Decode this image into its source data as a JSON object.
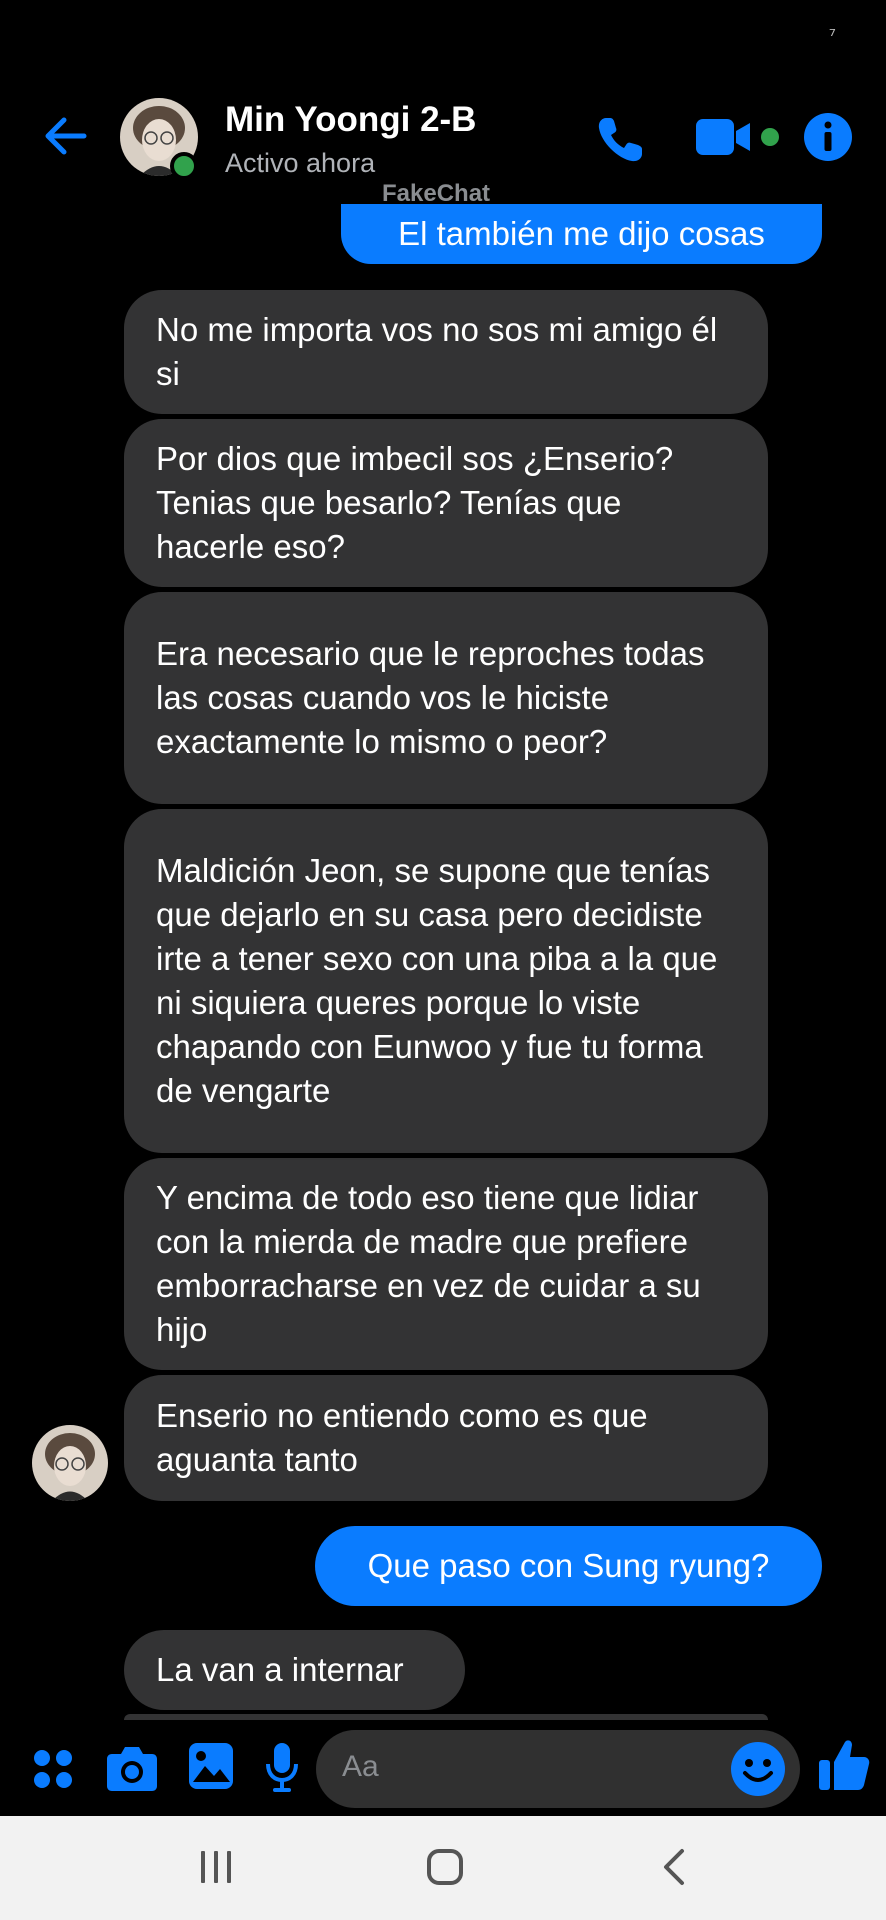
{
  "header": {
    "contact_name": "Min Yoongi 2-B",
    "contact_status": "Activo ahora",
    "watermark": "FakeChat"
  },
  "messages": [
    {
      "side": "sent",
      "text": "El también me dijo cosas"
    },
    {
      "side": "received",
      "text": "No me importa vos no sos mi amigo él si"
    },
    {
      "side": "received",
      "text": "Por dios que imbecil sos ¿Enserio? Tenias que besarlo? Tenías que hacerle eso?"
    },
    {
      "side": "received",
      "text": "Era necesario que le reproches todas las cosas cuando vos le hiciste exactamente lo mismo o peor?"
    },
    {
      "side": "received",
      "text": "Maldición Jeon, se supone que tenías que dejarlo en su casa pero decidiste irte a tener sexo con una piba a la que ni siquiera queres porque lo viste chapando con Eunwoo y fue tu forma de vengarte"
    },
    {
      "side": "received",
      "text": "Y encima de todo eso tiene que lidiar con la mierda de madre que prefiere emborracharse en vez de cuidar a su hijo"
    },
    {
      "side": "received",
      "text": "Enserio no entiendo como es que aguanta tanto"
    },
    {
      "side": "sent",
      "text": "Que paso con Sung ryung?"
    },
    {
      "side": "received",
      "text": "La van a internar"
    }
  ],
  "composer": {
    "placeholder": "Aa",
    "icons": [
      "apps-icon",
      "camera-icon",
      "gallery-icon",
      "microphone-icon",
      "emoji-icon",
      "like-icon"
    ]
  },
  "colors": {
    "accent": "#0a7cff",
    "received_bubble": "#333334",
    "online": "#31a24c",
    "background": "#000000"
  }
}
